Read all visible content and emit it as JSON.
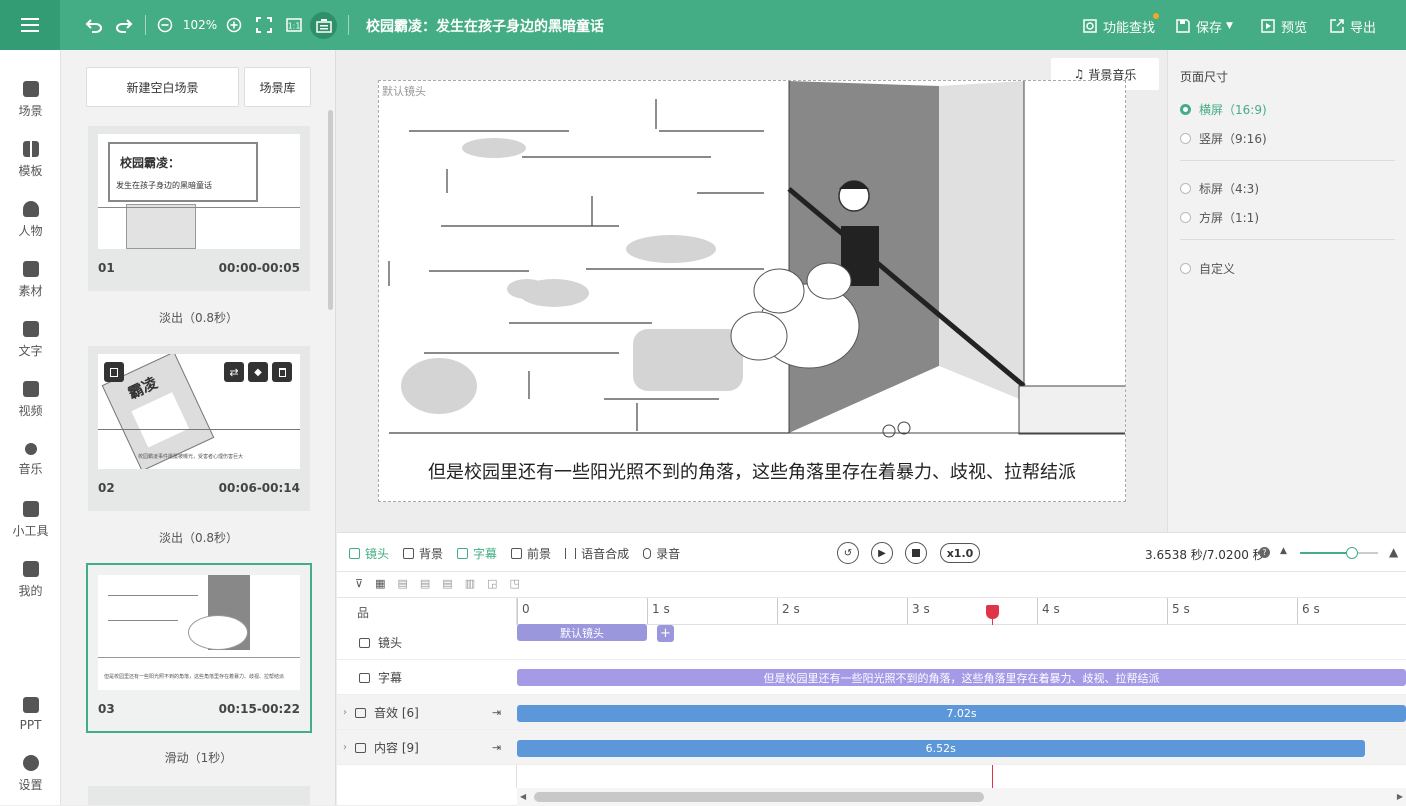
{
  "topbar": {
    "zoom": "102%",
    "title": "校园霸凌：发生在孩子身边的黑暗童话",
    "find_label": "功能查找",
    "save_label": "保存",
    "preview_label": "预览",
    "export_label": "导出"
  },
  "nav": [
    {
      "label": "场景",
      "icon": "scene-icon"
    },
    {
      "label": "模板",
      "icon": "template-icon"
    },
    {
      "label": "人物",
      "icon": "person-icon"
    },
    {
      "label": "素材",
      "icon": "material-icon"
    },
    {
      "label": "文字",
      "icon": "text-icon"
    },
    {
      "label": "视频",
      "icon": "video-icon"
    },
    {
      "label": "音乐",
      "icon": "music-icon"
    },
    {
      "label": "小工具",
      "icon": "tools-icon"
    },
    {
      "label": "我的",
      "icon": "my-icon"
    },
    {
      "label": "PPT",
      "icon": "ppt-icon"
    },
    {
      "label": "设置",
      "icon": "settings-icon"
    }
  ],
  "scenes": {
    "new_blank": "新建空白场景",
    "library": "场景库",
    "cards": [
      {
        "num": "01",
        "time": "00:00-00:05",
        "transition": "淡出（0.8秒）",
        "thumb_title": "校园霸凌：",
        "thumb_sub": "发生在孩子身边的黑暗童话"
      },
      {
        "num": "02",
        "time": "00:06-00:14",
        "transition": "淡出（0.8秒）",
        "thumb_title": "霸凌",
        "thumb_sub": "校园霸凌事件屡屡被曝光，受害者心理伤害巨大"
      },
      {
        "num": "03",
        "time": "00:15-00:22",
        "transition": "滑动（1秒）",
        "thumb_sub": "但是校园里还有一些阳光照不到的角落，这些角落里存在着暴力、歧视、拉帮结派"
      }
    ]
  },
  "stage": {
    "camera_label": "默认镜头",
    "bgm_label": "背景音乐",
    "subtitle": "但是校园里还有一些阳光照不到的角落，这些角落里存在着暴力、歧视、拉帮结派"
  },
  "right_panel": {
    "title": "页面尺寸",
    "options": [
      {
        "label": "横屏（16:9)",
        "selected": true
      },
      {
        "label": "竖屏（9:16)",
        "selected": false
      },
      {
        "label": "标屏（4:3)",
        "selected": false
      },
      {
        "label": "方屏（1:1)",
        "selected": false
      },
      {
        "label": "自定义",
        "selected": false
      }
    ]
  },
  "timeline": {
    "tabs": [
      "镜头",
      "背景",
      "字幕",
      "前景",
      "语音合成",
      "录音"
    ],
    "speed": "x1.0",
    "time_readout": "3.6538 秒/7.0200 秒",
    "ruler": [
      "0",
      "1 s",
      "2 s",
      "3 s",
      "4 s",
      "5 s",
      "6 s"
    ],
    "playhead_seconds": 3.6538,
    "zoom_fraction": 0.67,
    "tracks": [
      {
        "label": "镜头",
        "bar": "默认镜头",
        "color": "#9a97dd",
        "start_s": 0,
        "end_s": 1.0,
        "plus": true
      },
      {
        "label": "字幕",
        "bar": "但是校园里还有一些阳光照不到的角落，这些角落里存在着暴力、歧视、拉帮结派",
        "color": "#a59ae6",
        "start_s": 0,
        "end_s": 7.02
      },
      {
        "label": "音效 [6]",
        "bar": "7.02s",
        "color": "#5b97d9",
        "start_s": 0,
        "end_s": 7.02
      },
      {
        "label": "内容 [9]",
        "bar": "6.52s",
        "color": "#5b97d9",
        "start_s": 0,
        "end_s": 6.52
      }
    ]
  },
  "colors": {
    "accent": "#44ad85",
    "playhead": "#e0344a"
  }
}
